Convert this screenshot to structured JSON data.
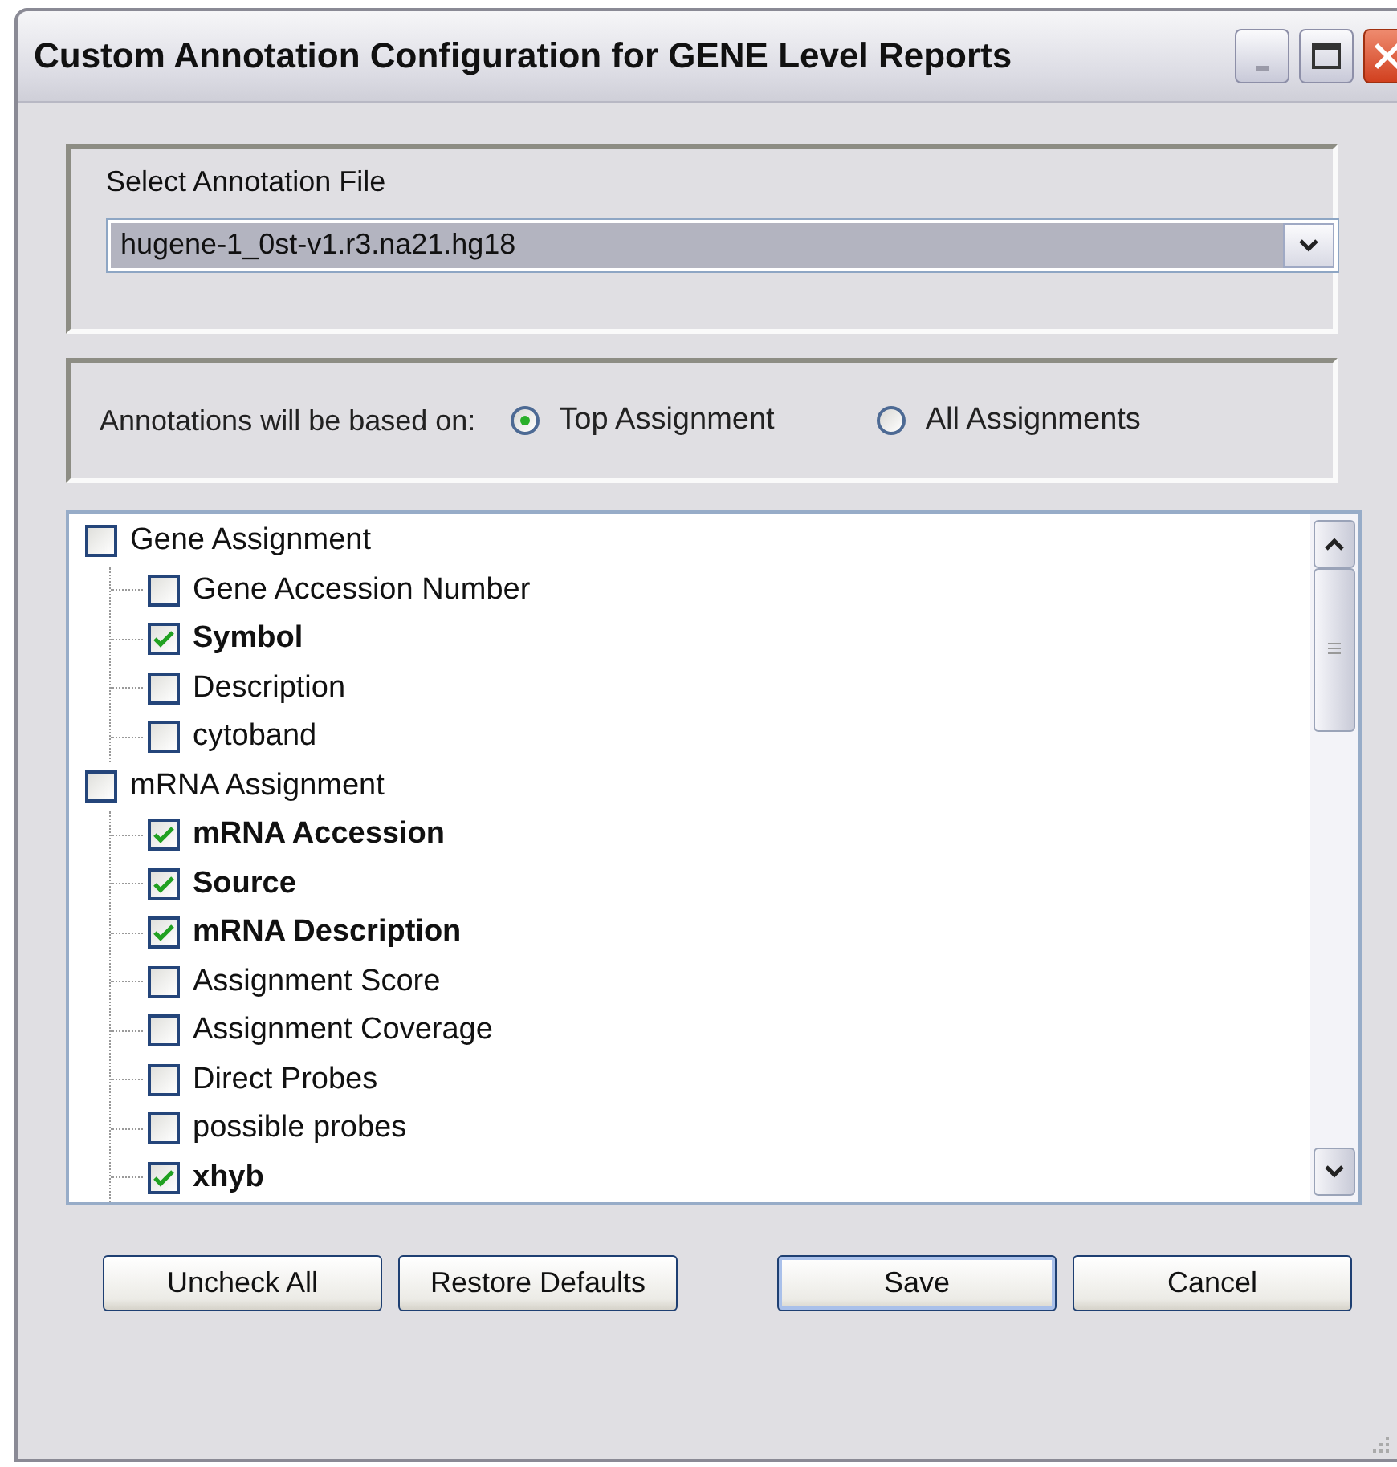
{
  "window": {
    "title": "Custom Annotation Configuration for GENE Level Reports"
  },
  "annotation_file": {
    "label": "Select Annotation File",
    "value": "hugene-1_0st-v1.r3.na21.hg18"
  },
  "basis": {
    "label": "Annotations will be based on:",
    "options": [
      {
        "label": "Top Assignment",
        "selected": true
      },
      {
        "label": "All Assignments",
        "selected": false
      }
    ]
  },
  "tree": [
    {
      "label": "Gene Assignment",
      "checked": false,
      "children": [
        {
          "label": "Gene Accession Number",
          "checked": false
        },
        {
          "label": "Symbol",
          "checked": true
        },
        {
          "label": "Description",
          "checked": false
        },
        {
          "label": "cytoband",
          "checked": false
        }
      ]
    },
    {
      "label": "mRNA Assignment",
      "checked": false,
      "children": [
        {
          "label": "mRNA Accession",
          "checked": true
        },
        {
          "label": "Source",
          "checked": true
        },
        {
          "label": "mRNA Description",
          "checked": true
        },
        {
          "label": "Assignment Score",
          "checked": false
        },
        {
          "label": "Assignment Coverage",
          "checked": false
        },
        {
          "label": "Direct Probes",
          "checked": false
        },
        {
          "label": "possible probes",
          "checked": false
        },
        {
          "label": "xhyb",
          "checked": true
        }
      ]
    }
  ],
  "buttons": [
    {
      "label": "Uncheck All",
      "default": false
    },
    {
      "label": "Restore Defaults",
      "default": false
    },
    {
      "label": "Save",
      "default": true
    },
    {
      "label": "Cancel",
      "default": false
    }
  ]
}
